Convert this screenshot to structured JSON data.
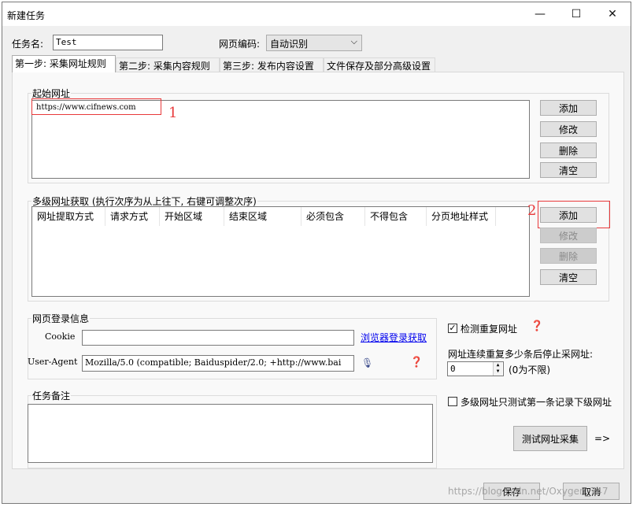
{
  "window": {
    "title": "新建任务",
    "minimize_glyph": "—",
    "maximize_glyph": "☐",
    "close_glyph": "✕"
  },
  "header": {
    "task_name_label": "任务名:",
    "task_name_value": "Test",
    "encoding_label": "网页编码:",
    "encoding_value": "自动识别"
  },
  "tabs": [
    {
      "label": "第一步: 采集网址规则",
      "active": true
    },
    {
      "label": "第二步: 采集内容规则",
      "active": false
    },
    {
      "label": "第三步: 发布内容设置",
      "active": false
    },
    {
      "label": "文件保存及部分高级设置",
      "active": false
    }
  ],
  "start_urls": {
    "title": "起始网址",
    "items": [
      "https://www.cifnews.com"
    ],
    "annotation": "1",
    "buttons": {
      "add": "添加",
      "edit": "修改",
      "delete": "删除",
      "clear": "清空"
    }
  },
  "multilevel": {
    "title": "多级网址获取 (执行次序为从上往下, 右键可调整次序)",
    "columns": [
      "网址提取方式",
      "请求方式",
      "开始区域",
      "结束区域",
      "必须包含",
      "不得包含",
      "分页地址样式"
    ],
    "annotation": "2",
    "buttons": {
      "add": "添加",
      "edit": "修改",
      "delete": "删除",
      "clear": "清空"
    }
  },
  "login": {
    "title": "网页登录信息",
    "cookie_label": "Cookie",
    "cookie_value": "",
    "browser_link": "浏览器登录获取",
    "ua_label": "User-Agent",
    "ua_value": "Mozilla/5.0 (compatible; Baiduspider/2.0; +http://www.bai"
  },
  "options": {
    "check_duplicate_label": "检测重复网址",
    "check_duplicate_checked": true,
    "stop_label": "网址连续重复多少条后停止采网址:",
    "stop_value": "0",
    "stop_hint": "(0为不限)",
    "test_first_label": "多级网址只测试第一条记录下级网址",
    "test_first_checked": false,
    "test_button": "测试网址采集",
    "arrow": "=>"
  },
  "notes": {
    "title": "任务备注",
    "value": ""
  },
  "footer": {
    "save": "保存",
    "cancel": "取消",
    "watermark": "https://blog.csdn.net/Oxygen_747"
  },
  "colors": {
    "annotation_red": "#e8393b",
    "window_bg": "#f0f0f0",
    "link_blue": "#0000ee"
  }
}
